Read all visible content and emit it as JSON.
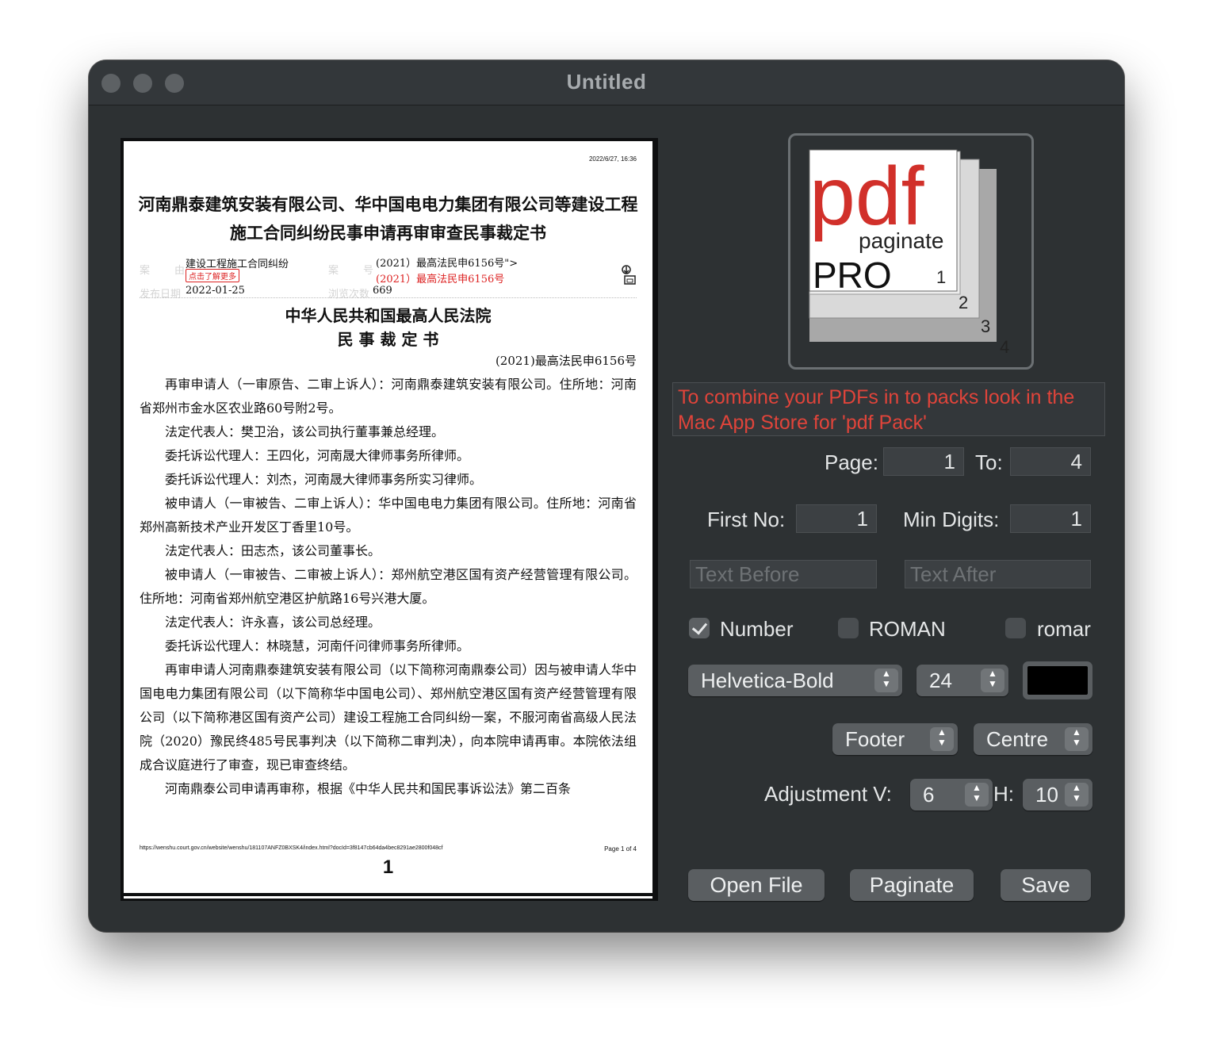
{
  "window": {
    "title": "Untitled"
  },
  "pdf": {
    "datetime": "2022/6/27, 16:36",
    "title": "河南鼎泰建筑安装有限公司、华中国电电力集团有限公司等建设工程施工合同纠纷民事申请再审审查民事裁定书",
    "meta": {
      "cause_label": "案",
      "cause_label2": "由",
      "cause_value": "建设工程施工合同纠纷",
      "more_badge": "点击了解更多",
      "caseno_label": "案",
      "caseno_label2": "号",
      "caseno_value1": "(2021）最高法民申6156号\">",
      "caseno_value2": "(2021）最高法民申6156号",
      "date_label": "发布日期",
      "date_value": "2022-01-25",
      "views_label": "浏览次数",
      "views_value": "669"
    },
    "court": "中华人民共和国最高人民法院",
    "doc_type": "民 事 裁 定 书",
    "case_no": "(2021)最高法民申6156号",
    "paragraphs": [
      "再审申请人（一审原告、二审上诉人）：河南鼎泰建筑安装有限公司。住所地：河南省郑州市金水区农业路60号附2号。",
      "法定代表人：樊卫治，该公司执行董事兼总经理。",
      "委托诉讼代理人：王四化，河南晟大律师事务所律师。",
      "委托诉讼代理人：刘杰，河南晟大律师事务所实习律师。",
      "被申请人（一审被告、二审上诉人）：华中国电电力集团有限公司。住所地：河南省郑州高新技术产业开发区丁香里10号。",
      "法定代表人：田志杰，该公司董事长。",
      "被申请人（一审被告、二审被上诉人）：郑州航空港区国有资产经营管理有限公司。住所地：河南省郑州航空港区护航路16号兴港大厦。",
      "法定代表人：许永喜，该公司总经理。",
      "委托诉讼代理人：林晓慧，河南仟问律师事务所律师。",
      "再审申请人河南鼎泰建筑安装有限公司（以下简称河南鼎泰公司）因与被申请人华中国电电力集团有限公司（以下简称华中国电公司）、郑州航空港区国有资产经营管理有限公司（以下简称港区国有资产公司）建设工程施工合同纠纷一案，不服河南省高级人民法院（2020）豫民终485号民事判决（以下简称二审判决），向本院申请再审。本院依法组成合议庭进行了审查，现已审查终结。",
      "河南鼎泰公司申请再审称，根据《中华人民共和国民事诉讼法》第二百条"
    ],
    "footer_url": "https://wenshu.court.gov.cn/website/wenshu/181107ANFZ0BXSK4/index.html?docId=3f8147cb64da4bec8291ae2800f048cf",
    "footer_page": "Page 1 of 4",
    "stamped_number": "1"
  },
  "logo": {
    "word_pdf": "pdf",
    "word_paginate": "paginate",
    "word_pro": "PRO",
    "num1": "1",
    "num2": "2",
    "num3": "3",
    "num4": "4",
    "red": "#d1302a"
  },
  "promo": "To combine your PDFs in to packs look in the Mac App Store for 'pdf Pack'",
  "form": {
    "page_label": "Page:",
    "page_value": "1",
    "to_label": "To:",
    "to_value": "4",
    "first_no_label": "First No:",
    "first_no_value": "1",
    "min_digits_label": "Min Digits:",
    "min_digits_value": "1",
    "text_before_placeholder": "Text Before",
    "text_after_placeholder": "Text After",
    "opt_number": "Number",
    "opt_number_checked": true,
    "opt_roman_upper": "ROMAN",
    "opt_roman_lower": "romar",
    "font": "Helvetica-Bold",
    "size": "24",
    "color": "#000000",
    "position": "Footer",
    "alignment": "Centre",
    "adjust_label": "Adjustment V:",
    "adjust_v": "6",
    "h_label": "H:",
    "adjust_h": "10"
  },
  "buttons": {
    "open": "Open File",
    "paginate": "Paginate",
    "save": "Save"
  }
}
